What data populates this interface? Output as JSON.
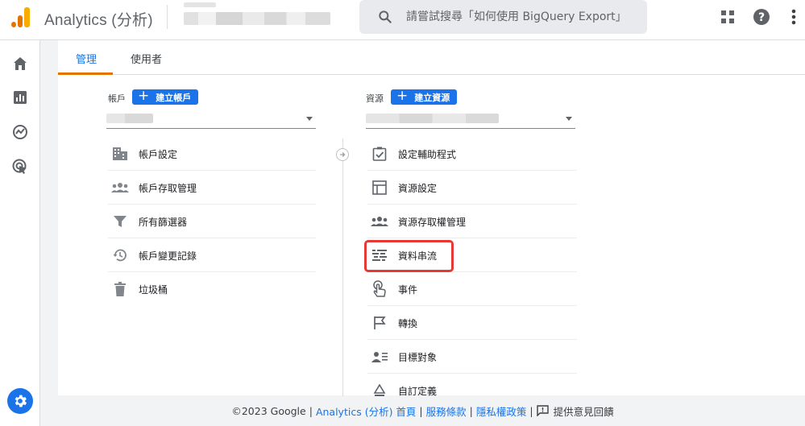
{
  "header": {
    "app_title": "Analytics (分析)",
    "search_placeholder": "請嘗試搜尋「如何使用 BigQuery Export」",
    "logo_colors": [
      "#f9ab00",
      "#e37400"
    ]
  },
  "tabs": [
    {
      "label": "管理",
      "active": true
    },
    {
      "label": "使用者",
      "active": false
    }
  ],
  "account": {
    "label": "帳戶",
    "create_label": "建立帳戶",
    "items": [
      {
        "label": "帳戶設定",
        "icon": "building-icon"
      },
      {
        "label": "帳戶存取管理",
        "icon": "people-icon"
      },
      {
        "label": "所有篩選器",
        "icon": "filter-icon"
      },
      {
        "label": "帳戶變更記錄",
        "icon": "history-icon"
      },
      {
        "label": "垃圾桶",
        "icon": "trash-icon"
      }
    ]
  },
  "property": {
    "label": "資源",
    "create_label": "建立資源",
    "items": [
      {
        "label": "設定輔助程式",
        "icon": "checklist-icon"
      },
      {
        "label": "資源設定",
        "icon": "layout-icon"
      },
      {
        "label": "資源存取權管理",
        "icon": "people-icon"
      },
      {
        "label": "資料串流",
        "icon": "streams-icon"
      },
      {
        "label": "事件",
        "icon": "touch-icon"
      },
      {
        "label": "轉換",
        "icon": "flag-icon"
      },
      {
        "label": "目標對象",
        "icon": "audience-icon"
      },
      {
        "label": "自訂定義",
        "icon": "custom-definition-icon"
      }
    ]
  },
  "footer": {
    "copyright": "©2023 Google",
    "home_link": "Analytics (分析) 首頁",
    "terms_link": "服務條款",
    "privacy_link": "隱私權政策",
    "feedback_label": "提供意見回饋"
  },
  "colors": {
    "accent": "#1a73e8",
    "tab_underline": "#e37400",
    "highlight": "#e53935"
  }
}
